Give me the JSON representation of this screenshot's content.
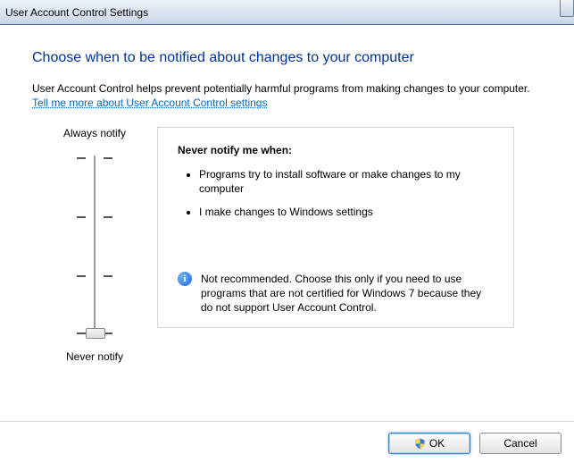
{
  "window": {
    "title": "User Account Control Settings"
  },
  "heading": "Choose when to be notified about changes to your computer",
  "description": "User Account Control helps prevent potentially harmful programs from making changes to your computer.",
  "link_text": "Tell me more about User Account Control settings",
  "slider": {
    "top_label": "Always notify",
    "bottom_label": "Never notify"
  },
  "panel": {
    "title": "Never notify me when:",
    "bullets": [
      "Programs try to install software or make changes to my computer",
      "I make changes to Windows settings"
    ],
    "note": "Not recommended. Choose this only if you need to use programs that are not certified for Windows 7 because they do not support User Account Control."
  },
  "buttons": {
    "ok": "OK",
    "cancel": "Cancel"
  }
}
